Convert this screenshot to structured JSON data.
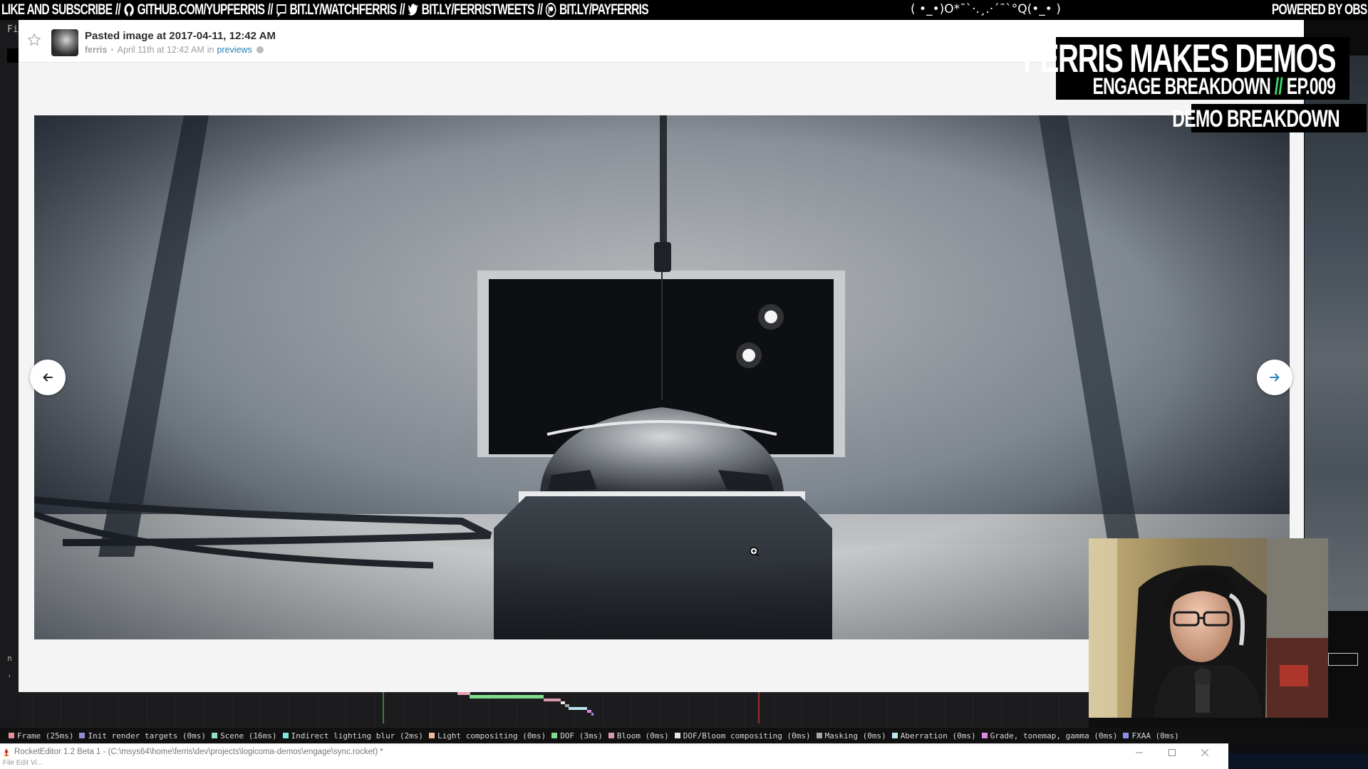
{
  "ticker": {
    "items": [
      "LIKE AND SUBSCRIBE",
      "GITHUB.COM/YUPFERRIS",
      "BIT.LY/WATCHFERRIS",
      "BIT.LY/FERRISTWEETS",
      "BIT.LY/PAYFERRIS"
    ],
    "separator": "//",
    "icons": [
      "none",
      "github-icon",
      "chat-icon",
      "twitter-icon",
      "patreon-icon"
    ],
    "face": "( •_•)O*¯`·.¸.·´¯`°Q(•_• )",
    "powered": "POWERED BY OBS"
  },
  "editor_bg": {
    "left_chars": [
      "Fi",
      "n",
      "'"
    ]
  },
  "file": {
    "title": "Pasted image at 2017-04-11, 12:42 AM",
    "author": "ferris",
    "date": "April 11th at 12:42 AM",
    "in_word": "in",
    "channel": "previews"
  },
  "overlay": {
    "title": "FERRIS MAKES DEMOS",
    "subtitle_pre": "ENGAGE BREAKDOWN",
    "subtitle_sep": "//",
    "subtitle_ep": "EP.009",
    "tag": "DEMO BREAKDOWN",
    "accent_color": "#3fe071"
  },
  "legend": [
    {
      "label": "Frame (25ms)",
      "color": "#e88d9c"
    },
    {
      "label": "Init render targets (0ms)",
      "color": "#8d8fd0"
    },
    {
      "label": "Scene (16ms)",
      "color": "#8fe2c6"
    },
    {
      "label": "Indirect lighting blur (2ms)",
      "color": "#7ee6d6"
    },
    {
      "label": "Light compositing (0ms)",
      "color": "#f0b99e"
    },
    {
      "label": "DOF (3ms)",
      "color": "#7fdc8d"
    },
    {
      "label": "Bloom (0ms)",
      "color": "#d99ab0"
    },
    {
      "label": "DOF/Bloom compositing (0ms)",
      "color": "#e8e8e8"
    },
    {
      "label": "Masking (0ms)",
      "color": "#a6a6a0"
    },
    {
      "label": "Aberration (0ms)",
      "color": "#bfe6f0"
    },
    {
      "label": "Grade, tonemap, gamma (0ms)",
      "color": "#d88be0"
    },
    {
      "label": "FXAA (0ms)",
      "color": "#8a8fe8"
    }
  ],
  "window": {
    "title": "RocketEditor 1.2 Beta 1 - (C:\\msys64\\home\\ferris\\dev\\projects\\logicoma-demos\\engage\\sync.rocket) *",
    "menu": "File  Edit  Vi..."
  }
}
